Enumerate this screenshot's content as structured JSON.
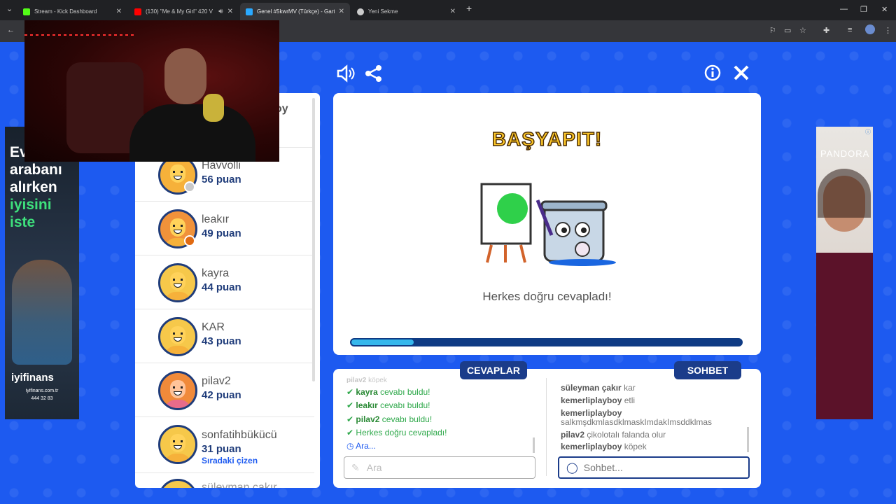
{
  "browser": {
    "tabs": [
      {
        "title": "Stream - Kick Dashboard",
        "color": "#53fc18"
      },
      {
        "title": "(130) \"Me & My Girl\" 420 V",
        "color": "#ff0000"
      },
      {
        "title": "Genel #5kwrMV (Türkçe) - Gart",
        "color": "#2aa9ff"
      },
      {
        "title": "Yeni Sekme",
        "color": "#cccccc"
      }
    ]
  },
  "ads": {
    "left": {
      "line1": "Ev",
      "line2": "arabanı",
      "line3": "alırken",
      "line4": "iyisini",
      "line5": "iste",
      "brand": "iyifinans",
      "site": "iyifinans.com.tr",
      "phone": "444 32 83"
    },
    "right": {
      "brand": "PANDORA"
    }
  },
  "players": [
    {
      "name": "Havvolli",
      "score": "56 puan",
      "badge": "#c9c9c9",
      "avatar": "#f6b13a"
    },
    {
      "name": "leakır",
      "score": "49 puan",
      "badge": "#e06a12",
      "avatar": "#f0923a"
    },
    {
      "name": "kayra",
      "score": "44 puan",
      "badge": "",
      "avatar": "#f6c84a"
    },
    {
      "name": "KAR",
      "score": "43 puan",
      "badge": "",
      "avatar": "#f6c84a"
    },
    {
      "name": "pilav2",
      "score": "42 puan",
      "badge": "",
      "avatar": "#f08a3a"
    },
    {
      "name": "sonfatihbükücü",
      "score": "31 puan",
      "badge": "",
      "avatar": "#f6c84a",
      "next": "Sıradaki çizen"
    }
  ],
  "partial_player": "süleyman çakır",
  "stage": {
    "title": "BAŞYAPIT!",
    "result": "Herkes doğru cevapladı!",
    "progress": 0.16
  },
  "tabs": {
    "answers": "CEVAPLAR",
    "chat": "SOHBET"
  },
  "answers": [
    {
      "user": "pilav2",
      "text": "köpek"
    },
    {
      "user": "kayra",
      "text": "cevabı buldu!"
    },
    {
      "user": "leakır",
      "text": "cevabı buldu!"
    },
    {
      "user": "pilav2",
      "text": "cevabı buldu!"
    },
    {
      "user": "",
      "text": "Herkes doğru cevapladı!"
    },
    {
      "user": "",
      "text": "Ara..."
    }
  ],
  "chat": [
    {
      "user": "süleyman çakır",
      "text": "kar"
    },
    {
      "user": "kemerliplayboy",
      "text": "etli"
    },
    {
      "user": "kemerliplayboy",
      "text": "salkmşdkmlasdklmaskImdakImsddklmas"
    },
    {
      "user": "pilav2",
      "text": "çikolotalı falanda olur"
    },
    {
      "user": "kemerliplayboy",
      "text": "köpek"
    }
  ],
  "inputs": {
    "answer_placeholder": "Ara",
    "chat_placeholder": "Sohbet..."
  }
}
